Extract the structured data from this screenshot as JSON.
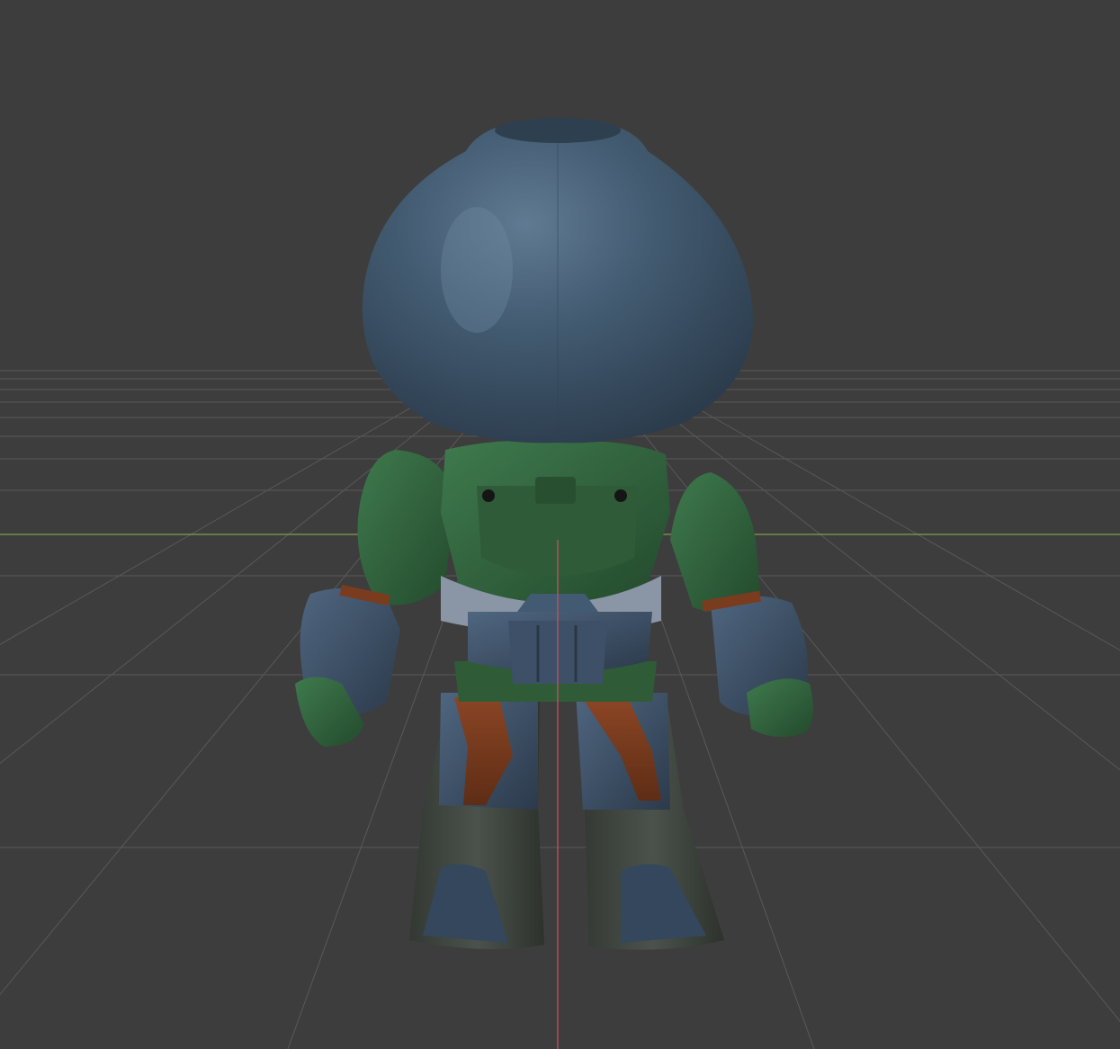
{
  "viewport": {
    "background": "#3d3d3d",
    "grid_color": "#585858",
    "x_axis_color": "#7f9f4f",
    "z_axis_color": "#c9555f",
    "grid_visible": true
  },
  "model": {
    "type": "sculpted-chibi-armored-figure",
    "view": "back",
    "colors": {
      "head": "#3e5468",
      "armor_green": "#2e5e3a",
      "armor_blue": "#3b4d63",
      "straps_brown": "#7a3c1f",
      "boots": "#3f4540",
      "metal_gray": "#8a96a6"
    }
  }
}
